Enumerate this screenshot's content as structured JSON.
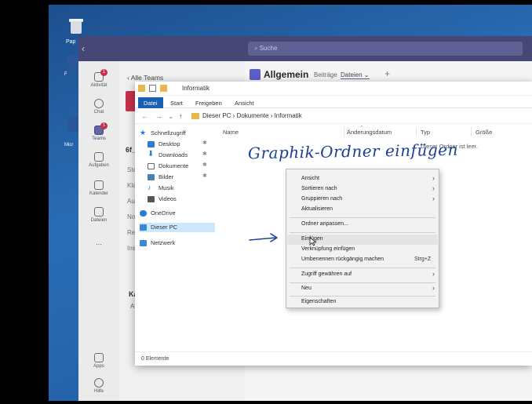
{
  "desktop": {
    "recycle_label": "Pap",
    "side_label_1": "F",
    "side_label_2": "Micr"
  },
  "teams": {
    "search_placeholder": "Suche",
    "back_label": "Alle Teams",
    "team_name": "6f_",
    "panel_rows": [
      "Star",
      "Klas",
      "Auf",
      "Noti",
      "Refl",
      "Insi"
    ],
    "kanal_heading": "Kan",
    "kanal_item": "Allg",
    "channel_name": "Allgemein",
    "channel_tabs": [
      "Beiträge",
      "Dateien"
    ],
    "rail": [
      {
        "label": "Aktivität",
        "icon": "bell-icon",
        "badge": "1"
      },
      {
        "label": "Chat",
        "icon": "chat-icon",
        "badge": ""
      },
      {
        "label": "Teams",
        "icon": "teams-icon",
        "badge": "1"
      },
      {
        "label": "Aufgaben",
        "icon": "tasks-icon",
        "badge": ""
      },
      {
        "label": "Kalender",
        "icon": "calendar-icon",
        "badge": ""
      },
      {
        "label": "Dateien",
        "icon": "files-icon",
        "badge": ""
      },
      {
        "label": "...",
        "icon": "more-icon",
        "badge": ""
      },
      {
        "label": "Apps",
        "icon": "apps-icon",
        "badge": ""
      },
      {
        "label": "Hilfe",
        "icon": "help-icon",
        "badge": ""
      }
    ]
  },
  "explorer": {
    "title": "Informatik",
    "ribbon_tabs": [
      "Datei",
      "Start",
      "Freigeben",
      "Ansicht"
    ],
    "breadcrumb": "Dieser PC  ›  Dokumente  ›  Informatik",
    "sidebar": [
      {
        "label": "Schnellzugriff",
        "pin": ""
      },
      {
        "label": "Desktop",
        "pin": "✱"
      },
      {
        "label": "Downloads",
        "pin": "✱"
      },
      {
        "label": "Dokumente",
        "pin": "✱"
      },
      {
        "label": "Bilder",
        "pin": "✱"
      },
      {
        "label": "Musik",
        "pin": ""
      },
      {
        "label": "Videos",
        "pin": ""
      },
      {
        "label": "OneDrive",
        "pin": ""
      },
      {
        "label": "Dieser PC",
        "pin": ""
      },
      {
        "label": "Netzwerk",
        "pin": ""
      }
    ],
    "columns": [
      "Name",
      "Änderungsdatum",
      "Typ",
      "Größe"
    ],
    "empty_message": "Dieser Ordner ist leer.",
    "status": "0 Elemente"
  },
  "context_menu": {
    "items": [
      {
        "label": "Ansicht",
        "shortcut": "",
        "submenu": true
      },
      {
        "label": "Sortieren nach",
        "shortcut": "",
        "submenu": true
      },
      {
        "label": "Gruppieren nach",
        "shortcut": "",
        "submenu": true
      },
      {
        "label": "Aktualisieren",
        "shortcut": "",
        "submenu": false
      },
      {
        "label": "Ordner anpassen...",
        "shortcut": "",
        "submenu": false
      },
      {
        "label": "Einfügen",
        "shortcut": "",
        "submenu": false
      },
      {
        "label": "Verknüpfung einfügen",
        "shortcut": "",
        "submenu": false
      },
      {
        "label": "Umbenennen rückgängig machen",
        "shortcut": "Strg+Z",
        "submenu": false
      },
      {
        "label": "Zugriff gewähren auf",
        "shortcut": "",
        "submenu": true
      },
      {
        "label": "Neu",
        "shortcut": "",
        "submenu": true
      },
      {
        "label": "Eigenschaften",
        "shortcut": "",
        "submenu": false
      }
    ]
  },
  "annotation": {
    "text": "Graphik-Ordner einfügen",
    "color": "#1c3f97"
  }
}
